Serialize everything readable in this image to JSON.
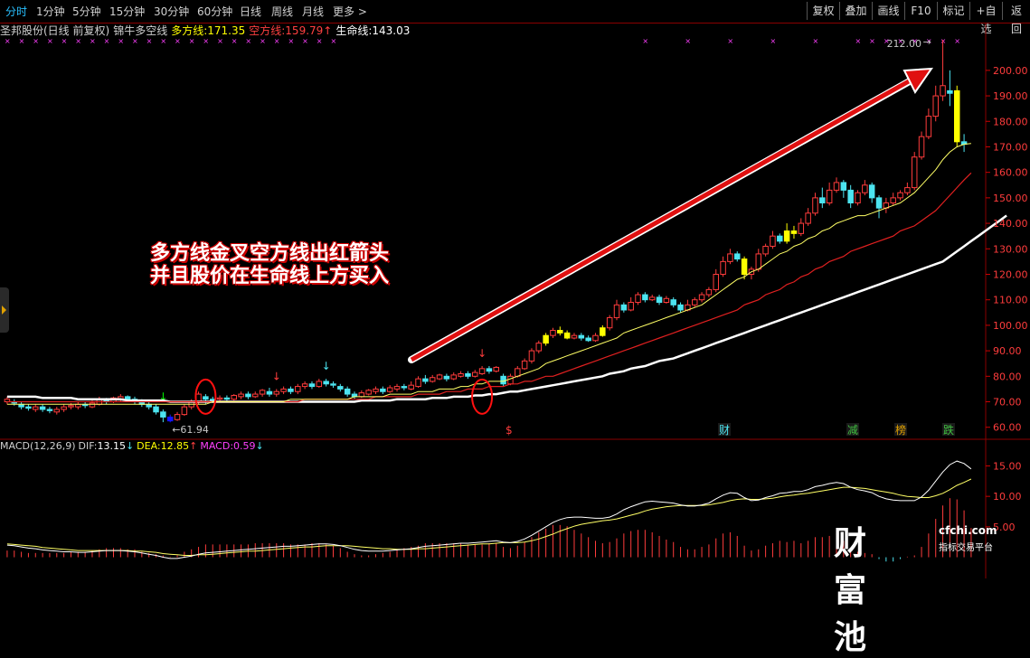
{
  "toolbar": {
    "timeframes": [
      "分时",
      "1分钟",
      "5分钟",
      "15分钟",
      "30分钟",
      "60分钟",
      "日线",
      "周线",
      "月线",
      "更多 >"
    ],
    "active_index": 0,
    "right_buttons": [
      "复权",
      "叠加",
      "画线",
      "F10",
      "标记",
      "+自选",
      "返回"
    ]
  },
  "infobar": {
    "stock": "圣邦股份(日线 前复权)",
    "indicator": "锦牛多空线",
    "bull_label": "多方线:",
    "bull_value": "171.35",
    "bear_label": "空方线:",
    "bear_value": "159.79",
    "bear_arrow": "↑",
    "life_label": "生命线:",
    "life_value": "143.03"
  },
  "macd": {
    "label": "MACD(12,26,9)",
    "dif_label": "DIF:",
    "dif_value": "13.15",
    "dif_arrow": "↓",
    "dea_label": "DEA:",
    "dea_value": "12.85",
    "dea_arrow": "↑",
    "macd_label": "MACD:",
    "macd_value": "0.59",
    "macd_arrow": "↓"
  },
  "annotation": [
    "多方线金叉空方线出红箭头",
    "并且股价在生命线上方买入"
  ],
  "watermark": {
    "logo": "财富池",
    "url": "cfchi.com",
    "sub": "指标交易平台"
  },
  "colors": {
    "up": "#ff3c3c",
    "down": "#4ce4f0",
    "yellow": "#ffff00",
    "blue": "#1414ff",
    "bull": "#ffff66",
    "bear": "#e02020",
    "life": "#ffffff",
    "magenta": "#ff40ff"
  },
  "chart_data": {
    "type": "candlestick",
    "price_axis": {
      "ticks": [
        "60.00",
        "70.00",
        "80.00",
        "90.00",
        "100.00",
        "110.00",
        "120.00",
        "130.00",
        "140.00",
        "150.00",
        "160.00",
        "170.00",
        "180.00",
        "190.00",
        "200.00"
      ],
      "ylim": [
        56,
        212
      ]
    },
    "high_label": "212.00",
    "low_label": "61.94",
    "event_markers": [
      "$",
      "财",
      "减",
      "榜",
      "跌"
    ],
    "candles": [
      [
        70,
        71,
        69,
        72
      ],
      [
        70,
        69.5,
        68.5,
        71
      ],
      [
        69,
        68,
        67,
        70
      ],
      [
        68,
        67.5,
        66.5,
        69
      ],
      [
        67,
        68,
        66,
        69
      ],
      [
        68,
        67,
        66,
        69
      ],
      [
        67,
        66.5,
        65.5,
        68
      ],
      [
        66,
        67,
        65,
        68
      ],
      [
        67,
        68,
        66,
        69
      ],
      [
        68,
        68.5,
        67,
        69.5
      ],
      [
        68,
        69,
        67,
        70
      ],
      [
        69,
        68.5,
        67.5,
        70
      ],
      [
        68,
        69.5,
        67.5,
        70.5
      ],
      [
        69,
        71,
        68.5,
        72
      ],
      [
        71,
        70,
        69,
        71.5
      ],
      [
        70,
        71.5,
        69.5,
        72
      ],
      [
        71,
        72,
        70,
        73
      ],
      [
        72,
        71,
        70,
        72.5
      ],
      [
        71,
        70.5,
        69,
        72
      ],
      [
        70,
        69,
        68,
        71
      ],
      [
        69,
        68,
        67,
        70
      ],
      [
        68,
        66,
        65,
        69
      ],
      [
        66,
        64,
        62,
        67
      ],
      [
        64,
        62.5,
        61.94,
        65
      ],
      [
        63,
        65,
        62.5,
        66
      ],
      [
        65,
        68,
        64.5,
        69
      ],
      [
        68,
        70,
        67,
        71
      ],
      [
        70,
        73,
        69,
        74
      ],
      [
        72,
        71,
        69,
        73
      ],
      [
        71,
        70.5,
        69.5,
        72
      ],
      [
        71,
        71.5,
        70,
        72.5
      ],
      [
        71.5,
        71,
        70,
        72.5
      ],
      [
        71,
        72.5,
        70.5,
        73
      ],
      [
        72,
        73,
        71,
        74
      ],
      [
        73,
        72,
        71,
        74
      ],
      [
        72,
        73,
        71.5,
        74
      ],
      [
        73,
        74.5,
        72,
        75
      ],
      [
        74,
        73,
        72,
        75.5
      ],
      [
        73,
        74,
        72,
        75
      ],
      [
        74,
        75,
        73,
        76
      ],
      [
        75,
        74,
        73,
        76
      ],
      [
        74,
        76,
        73,
        77
      ],
      [
        76,
        77,
        75,
        78
      ],
      [
        77,
        76,
        75,
        78
      ],
      [
        76,
        78,
        75.5,
        79
      ],
      [
        78,
        77,
        76,
        79
      ],
      [
        77,
        76.5,
        75.5,
        78
      ],
      [
        76,
        75,
        74,
        77
      ],
      [
        75,
        73,
        72,
        76
      ],
      [
        73,
        72,
        71,
        74
      ],
      [
        72,
        73.5,
        71.5,
        74.5
      ],
      [
        73,
        74.5,
        72.5,
        75
      ],
      [
        74,
        75,
        73,
        76
      ],
      [
        75,
        74,
        73,
        76
      ],
      [
        74,
        75.5,
        73.5,
        76.5
      ],
      [
        75,
        76,
        74,
        77
      ],
      [
        76,
        75.5,
        74.5,
        77
      ],
      [
        75,
        76.5,
        74.5,
        78
      ],
      [
        76,
        79,
        75.5,
        80
      ],
      [
        79,
        78,
        77,
        80.5
      ],
      [
        78,
        79.5,
        77.5,
        80.5
      ],
      [
        79,
        80.5,
        78.5,
        81
      ],
      [
        80,
        79,
        78,
        81
      ],
      [
        79,
        80.5,
        78.5,
        81.5
      ],
      [
        80,
        81,
        79.5,
        82
      ],
      [
        81,
        80,
        79,
        82
      ],
      [
        80,
        81.5,
        79.5,
        82.5
      ],
      [
        81,
        83,
        80.5,
        84
      ],
      [
        83,
        82,
        81,
        84
      ],
      [
        82,
        83.5,
        81.5,
        84
      ],
      [
        80,
        77,
        76,
        81
      ],
      [
        77,
        80,
        76.5,
        81
      ],
      [
        80,
        83,
        79.5,
        84
      ],
      [
        83,
        86,
        82.5,
        87
      ],
      [
        86,
        90,
        85,
        91
      ],
      [
        90,
        93,
        89,
        94
      ],
      [
        93,
        96,
        92,
        97
      ],
      [
        96,
        98,
        95,
        99
      ],
      [
        98,
        97,
        96,
        99.5
      ],
      [
        97,
        95,
        94.5,
        98
      ],
      [
        95,
        96,
        94.5,
        97
      ],
      [
        96,
        95,
        94,
        97
      ],
      [
        95,
        94,
        93.5,
        96
      ],
      [
        94,
        96,
        93.5,
        97
      ],
      [
        96,
        99,
        95.5,
        100
      ],
      [
        99,
        103,
        98,
        104
      ],
      [
        103,
        108,
        102,
        110
      ],
      [
        108,
        106,
        105,
        109
      ],
      [
        106,
        109,
        105.5,
        111
      ],
      [
        109,
        112,
        108,
        113
      ],
      [
        112,
        110,
        109,
        113
      ],
      [
        110,
        111,
        109.5,
        112
      ],
      [
        111,
        109,
        108,
        112
      ],
      [
        109,
        110.5,
        108.5,
        111.5
      ],
      [
        110,
        108,
        107,
        111
      ],
      [
        108,
        106,
        105,
        109
      ],
      [
        106,
        108,
        105.5,
        110
      ],
      [
        108,
        110,
        107,
        111
      ],
      [
        110,
        112,
        109,
        113
      ],
      [
        112,
        114,
        111,
        115
      ],
      [
        114,
        120,
        113,
        122
      ],
      [
        120,
        125,
        119,
        127
      ],
      [
        125,
        128,
        124,
        130
      ],
      [
        128,
        126,
        125,
        129
      ],
      [
        126,
        120,
        118,
        127
      ],
      [
        120,
        122,
        118,
        123
      ],
      [
        122,
        128,
        121,
        130
      ],
      [
        128,
        131,
        127,
        132
      ],
      [
        131,
        135,
        130,
        137
      ],
      [
        135,
        133,
        132,
        136
      ],
      [
        133,
        137,
        132,
        140
      ],
      [
        137,
        136,
        134,
        139
      ],
      [
        136,
        140,
        135,
        142
      ],
      [
        140,
        144,
        139,
        146
      ],
      [
        144,
        150,
        143,
        152
      ],
      [
        150,
        148,
        146,
        154
      ],
      [
        148,
        153,
        147,
        156
      ],
      [
        153,
        156,
        152,
        158
      ],
      [
        156,
        153,
        150,
        157
      ],
      [
        153,
        148,
        146,
        155
      ],
      [
        148,
        152,
        147,
        153
      ],
      [
        152,
        155,
        151,
        157
      ],
      [
        155,
        150,
        148,
        156
      ],
      [
        150,
        146,
        142,
        151
      ],
      [
        146,
        148,
        144,
        150
      ],
      [
        148,
        150,
        147,
        152
      ],
      [
        150,
        152,
        149,
        153
      ],
      [
        152,
        154,
        151,
        156
      ],
      [
        154,
        166,
        153,
        168
      ],
      [
        166,
        174,
        165,
        176
      ],
      [
        174,
        182,
        173,
        185
      ],
      [
        182,
        190,
        180,
        194
      ],
      [
        190,
        194,
        188,
        212
      ],
      [
        192,
        191,
        186,
        200
      ],
      [
        192,
        172,
        170,
        194
      ],
      [
        172,
        171,
        168,
        175
      ]
    ],
    "special_candles": {
      "yellow": [
        76,
        78,
        79,
        84,
        104,
        110,
        111,
        134
      ],
      "blue": [
        23,
        138
      ]
    },
    "bull_line": [
      69,
      69,
      69,
      69,
      69,
      69,
      69,
      69,
      69,
      69,
      69,
      69,
      69,
      69,
      69,
      69,
      69,
      69,
      69,
      69,
      69,
      69,
      69,
      69,
      69,
      69,
      69,
      69,
      69,
      70,
      70,
      70,
      70,
      70,
      70,
      70,
      70,
      70,
      70,
      70,
      71,
      71,
      71,
      71,
      71,
      71,
      71,
      71,
      71,
      72,
      72,
      72,
      72,
      72,
      73,
      73,
      73,
      73,
      74,
      74,
      74,
      75,
      75,
      75,
      76,
      76,
      77,
      77,
      78,
      78,
      78,
      79,
      80,
      81,
      82,
      83,
      85,
      86,
      87,
      88,
      89,
      90,
      91,
      92,
      93,
      94,
      95,
      97,
      98,
      99,
      100,
      101,
      102,
      103,
      104,
      105,
      106,
      107,
      108,
      110,
      112,
      114,
      116,
      118,
      119,
      121,
      122,
      124,
      126,
      128,
      129,
      131,
      132,
      134,
      135,
      137,
      138,
      140,
      141,
      142,
      143,
      143,
      144,
      145,
      146,
      147,
      148,
      150,
      152,
      155,
      158,
      161,
      165,
      168,
      170,
      171,
      171.35
    ],
    "bear_line": [
      70,
      70,
      70,
      70,
      70,
      70,
      70,
      70,
      70,
      70,
      70,
      70,
      70,
      70,
      70,
      70,
      70,
      70,
      70,
      70,
      70,
      70,
      70,
      70,
      70,
      70,
      70,
      70,
      70,
      70,
      70,
      70,
      70,
      70,
      70,
      70,
      70,
      70,
      70,
      70,
      70,
      70,
      71,
      71,
      71,
      71,
      71,
      71,
      71,
      71,
      71,
      71,
      72,
      72,
      72,
      72,
      72,
      72,
      73,
      73,
      73,
      73,
      74,
      74,
      74,
      75,
      75,
      75,
      76,
      76,
      76,
      77,
      77,
      78,
      78,
      79,
      80,
      80,
      81,
      82,
      83,
      84,
      85,
      86,
      87,
      88,
      89,
      90,
      91,
      92,
      93,
      94,
      95,
      96,
      97,
      98,
      99,
      100,
      101,
      102,
      103,
      104,
      105,
      106,
      108,
      109,
      110,
      112,
      113,
      114,
      116,
      117,
      119,
      120,
      122,
      123,
      125,
      126,
      127,
      129,
      130,
      131,
      132,
      133,
      134,
      135,
      137,
      138,
      139,
      141,
      143,
      145,
      148,
      151,
      154,
      157,
      159.79
    ],
    "life_line": [
      72,
      72,
      72,
      72,
      72,
      71.5,
      71.5,
      71.5,
      71.5,
      71.5,
      71,
      71,
      71,
      71,
      71,
      71,
      71,
      70.5,
      70.5,
      70.5,
      70.5,
      70.5,
      70.5,
      70,
      70,
      70,
      70,
      70,
      70,
      70,
      70,
      70,
      70,
      70,
      70,
      70,
      70,
      70,
      70,
      70,
      70,
      70,
      70,
      70,
      70,
      70,
      70,
      70,
      70,
      70,
      70.5,
      70.5,
      70.5,
      70.5,
      70.5,
      71,
      71,
      71,
      71,
      71,
      71.5,
      71.5,
      71.5,
      72,
      72,
      72,
      72.5,
      72.5,
      73,
      73,
      73.5,
      74,
      74,
      74.5,
      75,
      75.5,
      76,
      76.5,
      77,
      77.5,
      78,
      78.5,
      79,
      79.5,
      80,
      81,
      81.5,
      82,
      83,
      83.5,
      84,
      85,
      86,
      86.5,
      87,
      88,
      89,
      90,
      91,
      92,
      93,
      94,
      95,
      96,
      97,
      98,
      99,
      100,
      101,
      102,
      103,
      104,
      105,
      106,
      107,
      108,
      109,
      110,
      111,
      112,
      113,
      114,
      115,
      116,
      117,
      118,
      119,
      120,
      121,
      122,
      123,
      124,
      125,
      127,
      129,
      131,
      133,
      135,
      137,
      139,
      141,
      143.03
    ],
    "macd_axis": {
      "ticks": [
        "5.00",
        "10.00",
        "15.00"
      ],
      "ylim": [
        -2,
        17
      ]
    },
    "dif": [
      2,
      1.9,
      1.7,
      1.5,
      1.4,
      1.2,
      1.1,
      1,
      0.9,
      0.9,
      0.8,
      0.8,
      0.9,
      1,
      1.1,
      1.1,
      1.1,
      1,
      0.9,
      0.7,
      0.5,
      0.3,
      0,
      -0.2,
      -0.2,
      0,
      0.2,
      0.5,
      0.7,
      0.8,
      0.9,
      1,
      1.1,
      1.2,
      1.3,
      1.4,
      1.5,
      1.6,
      1.7,
      1.8,
      1.8,
      1.9,
      2,
      2.1,
      2.2,
      2.2,
      2.1,
      1.9,
      1.6,
      1.3,
      1.1,
      1,
      1,
      1,
      1.1,
      1.2,
      1.3,
      1.4,
      1.6,
      1.8,
      1.9,
      2,
      2.1,
      2.2,
      2.3,
      2.3,
      2.4,
      2.5,
      2.6,
      2.7,
      2.5,
      2.4,
      2.6,
      3,
      3.6,
      4.3,
      5,
      5.7,
      6.2,
      6.5,
      6.6,
      6.6,
      6.5,
      6.4,
      6.4,
      6.6,
      7.1,
      7.8,
      8.3,
      8.7,
      9.1,
      9.2,
      9.1,
      9,
      8.9,
      8.6,
      8.4,
      8.4,
      8.6,
      8.9,
      9.6,
      10.2,
      10.6,
      10.5,
      9.8,
      9.3,
      9.4,
      9.8,
      10.1,
      10.5,
      10.6,
      10.8,
      10.8,
      11.1,
      11.6,
      11.8,
      12.1,
      12.3,
      12.1,
      11.5,
      11.1,
      10.9,
      10.6,
      10,
      9.6,
      9.4,
      9.3,
      9.3,
      9.3,
      9.9,
      11,
      12.5,
      14,
      15.2,
      15.8,
      15.4,
      14.5
    ],
    "dea": [
      2.2,
      2.1,
      2,
      1.9,
      1.8,
      1.6,
      1.5,
      1.4,
      1.3,
      1.2,
      1.1,
      1.1,
      1.1,
      1.1,
      1.1,
      1.1,
      1.1,
      1.1,
      1,
      1,
      0.9,
      0.8,
      0.6,
      0.5,
      0.4,
      0.3,
      0.3,
      0.4,
      0.4,
      0.5,
      0.6,
      0.7,
      0.8,
      0.9,
      1,
      1,
      1.1,
      1.2,
      1.3,
      1.4,
      1.5,
      1.6,
      1.7,
      1.7,
      1.8,
      1.9,
      1.9,
      1.9,
      1.9,
      1.8,
      1.7,
      1.6,
      1.5,
      1.4,
      1.4,
      1.3,
      1.3,
      1.3,
      1.4,
      1.4,
      1.5,
      1.6,
      1.7,
      1.8,
      1.9,
      2,
      2.1,
      2.2,
      2.2,
      2.3,
      2.4,
      2.4,
      2.4,
      2.5,
      2.7,
      3,
      3.4,
      3.8,
      4.3,
      4.7,
      5.1,
      5.4,
      5.6,
      5.8,
      6,
      6.1,
      6.3,
      6.6,
      6.9,
      7.2,
      7.6,
      7.9,
      8.1,
      8.3,
      8.4,
      8.5,
      8.5,
      8.5,
      8.5,
      8.6,
      8.8,
      9,
      9.3,
      9.5,
      9.6,
      9.5,
      9.5,
      9.6,
      9.7,
      9.9,
      10.1,
      10.2,
      10.4,
      10.5,
      10.7,
      10.9,
      11.1,
      11.3,
      11.5,
      11.5,
      11.4,
      11.3,
      11.1,
      10.9,
      10.7,
      10.5,
      10.2,
      10,
      9.9,
      9.8,
      9.8,
      10.1,
      10.5,
      11.1,
      11.8,
      12.3,
      12.85
    ]
  }
}
